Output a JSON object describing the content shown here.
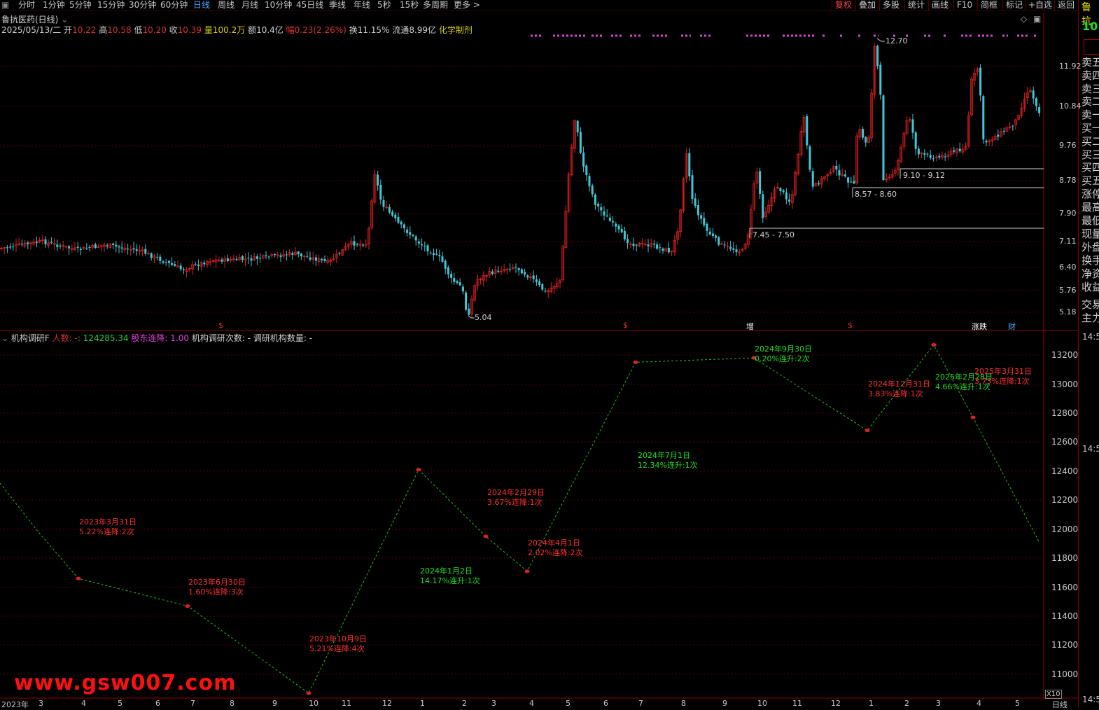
{
  "toolbar": {
    "periods": [
      "分时",
      "1分钟",
      "5分钟",
      "15分钟",
      "30分钟",
      "60分钟",
      "日线",
      "周线",
      "月线",
      "10分钟",
      "45日线",
      "季线",
      "年线",
      "5秒",
      "15秒",
      "多周期",
      "更多 >"
    ],
    "active_period": "日线",
    "right_buttons": [
      "复权",
      "叠加",
      "多股",
      "统计",
      "画线",
      "F10",
      "简框",
      "标记",
      "+自选",
      "返回"
    ],
    "active_right": "复权"
  },
  "stock": {
    "title": "鲁抗医药(日线)",
    "date": "2025/05/13/二",
    "open_label": "开",
    "open": "10.22",
    "high_label": "高",
    "high": "10.58",
    "low_label": "低",
    "low": "10.20",
    "close_label": "收",
    "close": "10.39",
    "vol_label": "量",
    "vol": "100.2万",
    "amt_label": "额",
    "amt": "10.4亿",
    "chg_label": "幅",
    "chg": "0.23(2.26%)",
    "turn_label": "换",
    "turn": "11.15%",
    "float_label": "流通",
    "float": "8.99亿",
    "sector": "化学制剂"
  },
  "right_panel": {
    "top": "鲁抗",
    "price": "10",
    "labels": [
      "卖五",
      "卖四",
      "卖三",
      "卖二",
      "卖一",
      "买一",
      "买二",
      "买三",
      "买四",
      "买五",
      "涨停",
      "最高",
      "最低",
      "现量",
      "外盘",
      "换手",
      "净资",
      "收益",
      "交易",
      "主力"
    ]
  },
  "price_axis": [
    "11.92",
    "10.84",
    "9.76",
    "8.78",
    "7.90",
    "7.11",
    "6.40",
    "5.76",
    "5.18"
  ],
  "price_marks": {
    "high": "12.70",
    "low": "5.04",
    "ranges": [
      "9.10 - 9.12",
      "8.57 - 8.60",
      "7.45 - 7.50"
    ]
  },
  "event_marks": [
    "$",
    "$",
    "增",
    "$",
    "涨跌",
    "财"
  ],
  "indicator": {
    "name": "机构调研F",
    "people_label": "人数: -",
    "people_value": ": 124285.34",
    "holder_label": "股东连降: 1.00",
    "count_label": "机构调研次数: -",
    "org_label": "调研机构数量: -"
  },
  "indicator_axis": [
    "13200",
    "13000",
    "12800",
    "12600",
    "12400",
    "12200",
    "12000",
    "11800",
    "11600",
    "11400",
    "11200",
    "11000"
  ],
  "right_time_labels": [
    "14:5",
    "14:5",
    "14:5"
  ],
  "x_axis": [
    "2023年",
    "3",
    "4",
    "5",
    "6",
    "7",
    "8",
    "9",
    "10",
    "11",
    "12",
    "1",
    "2",
    "3",
    "4",
    "5",
    "6",
    "7",
    "8",
    "9",
    "10",
    "11",
    "12",
    "1",
    "2",
    "3",
    "4",
    "5"
  ],
  "x_right": "日线",
  "zoom": "X10",
  "watermark": "www.gsw007.com",
  "chart_data": {
    "type": "line",
    "title": "机构调研F",
    "series": [
      {
        "name": "人数",
        "points": [
          {
            "date": "2023年3月31日",
            "value": 11660,
            "note": "5.22%连降:2次",
            "color": "#ff3030"
          },
          {
            "date": "2023年6月30日",
            "value": 11470,
            "note": "1.60%连降:3次",
            "color": "#ff3030"
          },
          {
            "date": "2023年10月9日",
            "value": 10870,
            "note": "5.21%连降:4次",
            "color": "#ff3030"
          },
          {
            "date": "2024年1月2日",
            "value": 12410,
            "note": "14.17%连升:1次",
            "color": "#20e020"
          },
          {
            "date": "2024年2月29日",
            "value": 11950,
            "note": "3.67%连降:1次",
            "color": "#ff3030"
          },
          {
            "date": "2024年4月1日",
            "value": 11710,
            "note": "2.02%连降:2次",
            "color": "#ff3030"
          },
          {
            "date": "2024年7月1日",
            "value": 13150,
            "note": "12.34%连升:1次",
            "color": "#20e020"
          },
          {
            "date": "2024年9月30日",
            "value": 13180,
            "note": "0.20%连升:2次",
            "color": "#20e020"
          },
          {
            "date": "2024年12月31日",
            "value": 12680,
            "note": "3.83%连降:1次",
            "color": "#ff3030"
          },
          {
            "date": "2025年2月28日",
            "value": 13270,
            "note": "4.66%连升:1次",
            "color": "#20e020"
          },
          {
            "date": "2025年3月31日",
            "value": 12770,
            "note": "3.73%连降:1次",
            "color": "#ff3030"
          }
        ]
      }
    ],
    "ylim": [
      10870,
      13300
    ]
  }
}
